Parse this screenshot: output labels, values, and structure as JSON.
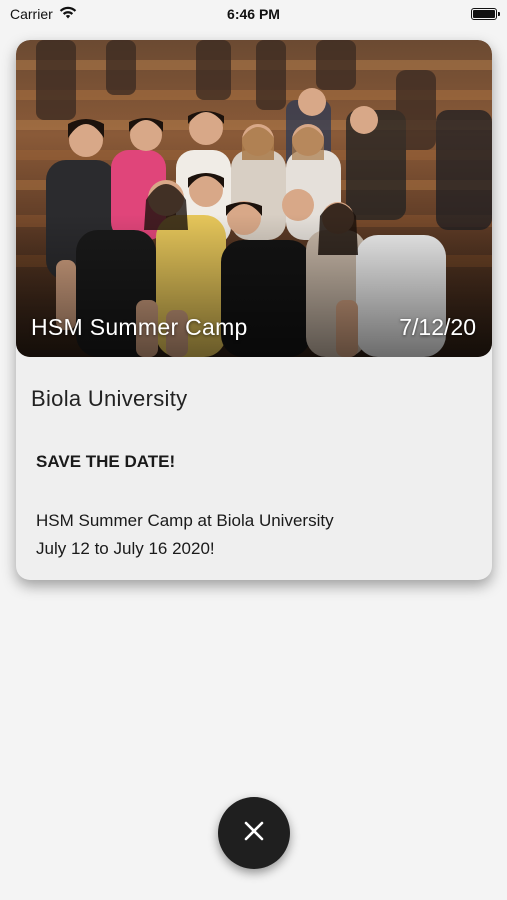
{
  "status_bar": {
    "carrier": "Carrier",
    "time": "6:46 PM",
    "icons": [
      "wifi-icon",
      "battery-icon"
    ]
  },
  "event_card": {
    "title": "HSM Summer Camp",
    "date": "7/12/20",
    "location": "Biola University",
    "headline": "SAVE THE DATE!",
    "body_line_1": "HSM Summer Camp at Biola University",
    "body_line_2": "July 12 to July 16 2020!",
    "image": "group-photo-of-campers-on-bleachers"
  },
  "close_button": {
    "icon": "close-icon",
    "color": "#1f1f1f"
  }
}
